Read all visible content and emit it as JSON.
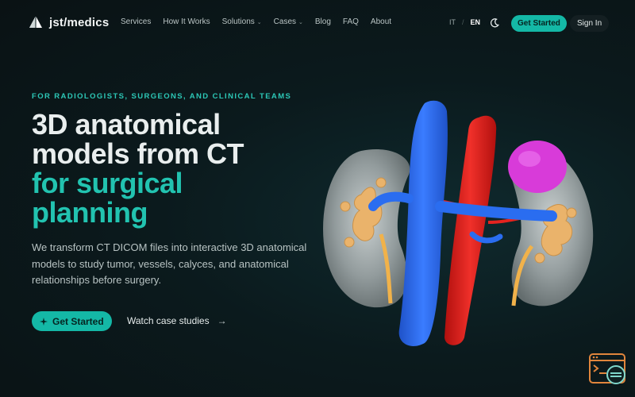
{
  "brand": {
    "name": "jst/medics",
    "logo_icon": "prism-logo-icon"
  },
  "nav": {
    "items": [
      {
        "label": "Services",
        "has_dropdown": false
      },
      {
        "label": "How It Works",
        "has_dropdown": false
      },
      {
        "label": "Solutions",
        "has_dropdown": true
      },
      {
        "label": "Cases",
        "has_dropdown": true
      },
      {
        "label": "Blog",
        "has_dropdown": false
      },
      {
        "label": "FAQ",
        "has_dropdown": false
      },
      {
        "label": "About",
        "has_dropdown": false
      }
    ],
    "lang_it": "IT",
    "lang_sep": "/",
    "lang_en": "EN",
    "theme_icon": "moon-icon",
    "get_started": "Get Started",
    "sign_in": "Sign In"
  },
  "hero": {
    "eyebrow": "FOR RADIOLOGISTS, SURGEONS, AND CLINICAL TEAMS",
    "headline_white_1": "3D anatomical",
    "headline_white_2": "models from CT",
    "headline_teal_1": "for surgical",
    "headline_teal_2": "planning",
    "subtext": "We transform CT DICOM files into interactive 3D anatomical models to study tumor, vessels, calyces, and anatomical relationships before surgery.",
    "cta_primary": "Get Started",
    "cta_secondary": "Watch case studies",
    "cta_secondary_arrow": "→"
  },
  "colors": {
    "accent": "#14b8a6",
    "accent_text": "#22c3b0",
    "background": "#0b1a1d",
    "vein": "#2a6df0",
    "artery": "#e5231f",
    "tumor": "#d83bd9",
    "calyx": "#eab36b"
  }
}
